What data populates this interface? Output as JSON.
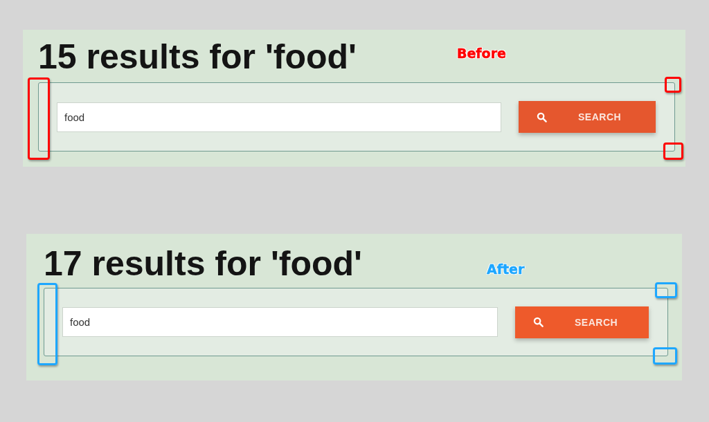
{
  "panels": [
    {
      "heading": "15 results for 'food'",
      "label": "Before",
      "color": "#ff0000",
      "search": {
        "value": "food"
      },
      "button": "SEARCH"
    },
    {
      "heading": "17 results for 'food'",
      "label": "After",
      "color": "#1ea7ff",
      "search": {
        "value": "food"
      },
      "button": "SEARCH"
    }
  ]
}
